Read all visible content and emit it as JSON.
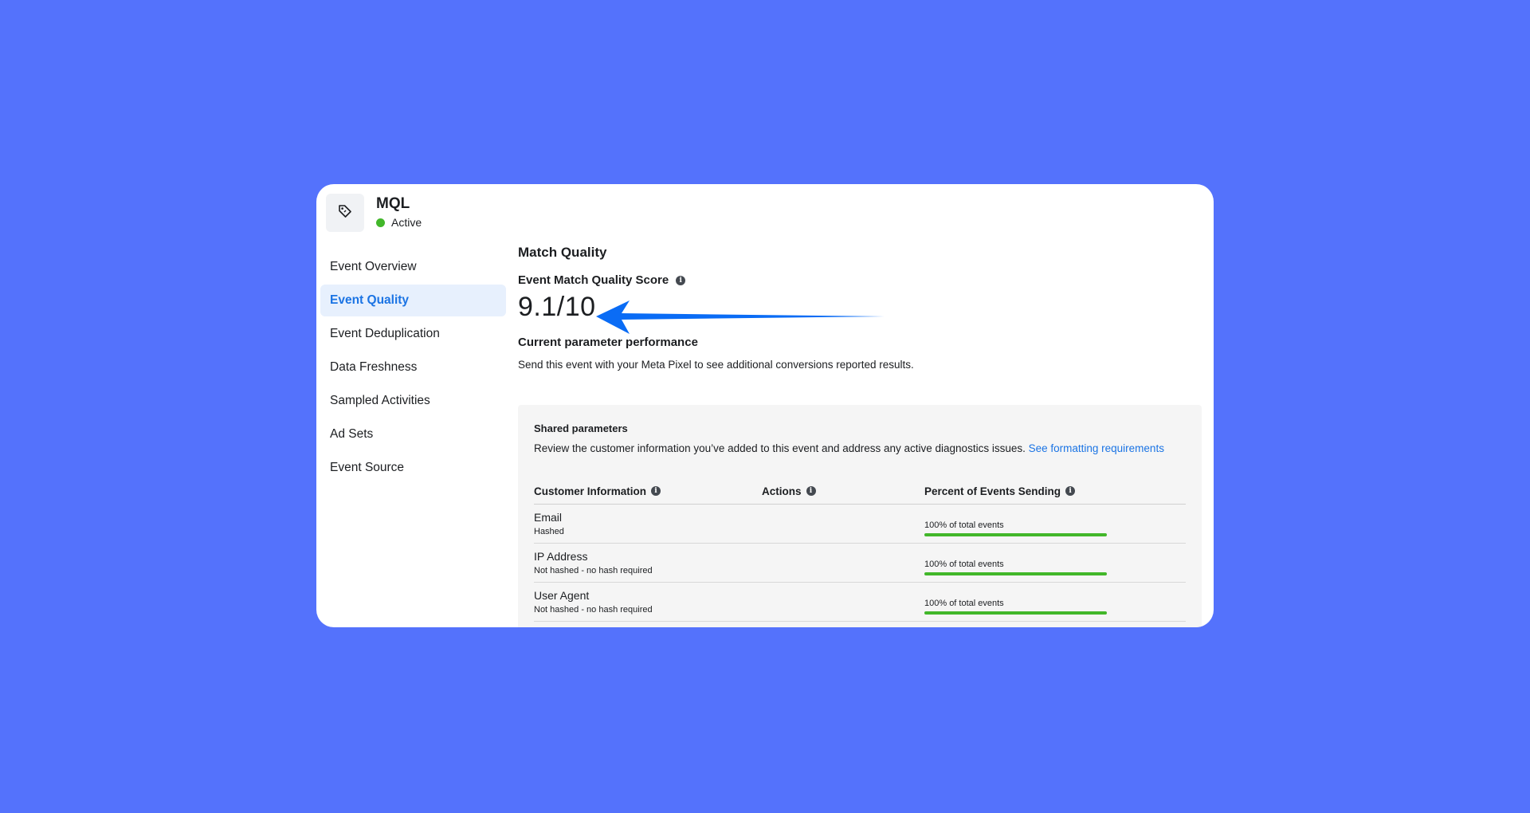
{
  "event": {
    "icon": "tag-icon",
    "name": "MQL",
    "status": "Active",
    "status_color": "#42b72a"
  },
  "sidebar": {
    "items": [
      {
        "label": "Event Overview"
      },
      {
        "label": "Event Quality",
        "active": true
      },
      {
        "label": "Event Deduplication"
      },
      {
        "label": "Data Freshness"
      },
      {
        "label": "Sampled Activities"
      },
      {
        "label": "Ad Sets"
      },
      {
        "label": "Event Source"
      }
    ]
  },
  "main": {
    "section_title": "Match Quality",
    "score_label": "Event Match Quality Score",
    "score_value": "9.1/10",
    "param_title": "Current parameter performance",
    "param_desc": "Send this event with your Meta Pixel to see additional conversions reported results."
  },
  "shared": {
    "title": "Shared parameters",
    "desc": "Review the customer information you’ve added to this event and address any active diagnostics issues.",
    "link": "See formatting requirements"
  },
  "table": {
    "headers": [
      "Customer Information",
      "Actions",
      "Percent of Events Sending"
    ],
    "rows": [
      {
        "name": "Email",
        "sub": "Hashed",
        "pct_text": "100% of total events",
        "pct": 100
      },
      {
        "name": "IP Address",
        "sub": "Not hashed - no hash required",
        "pct_text": "100% of total events",
        "pct": 100
      },
      {
        "name": "User Agent",
        "sub": "Not hashed - no hash required",
        "pct_text": "100% of total events",
        "pct": 100
      }
    ]
  },
  "colors": {
    "background": "#5472fc",
    "accent": "#1b74e4",
    "arrow": "#0a6cf5",
    "bar": "#42b72a"
  }
}
